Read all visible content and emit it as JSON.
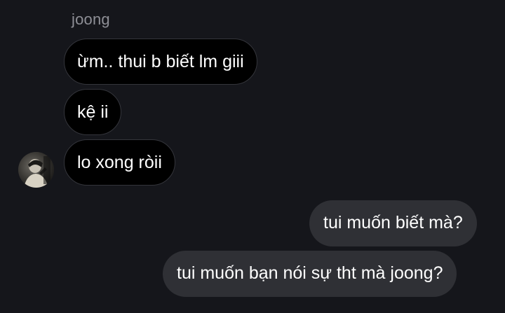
{
  "conversation": {
    "sender_name": "joong",
    "incoming_messages": [
      {
        "text": "ừm.. thui b biết lm giii"
      },
      {
        "text": "kệ ii"
      },
      {
        "text": "lo xong ròii"
      }
    ],
    "outgoing_messages": [
      {
        "text": "tui muốn biết mà?"
      },
      {
        "text": "tui muốn bạn nói sự tht mà joong?"
      }
    ]
  },
  "colors": {
    "background": "#15161b",
    "incoming_bubble": "#000000",
    "incoming_border": "#34353b",
    "outgoing_bubble": "#2f3035",
    "text": "#ffffff",
    "sender_name": "#8e8f96"
  },
  "icons": {
    "avatar": "contact-avatar-photo"
  }
}
